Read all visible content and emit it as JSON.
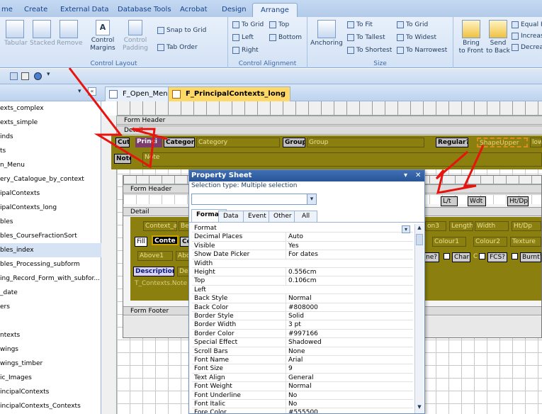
{
  "ribbon_tabs": [
    "me",
    "Create",
    "External Data",
    "Database Tools",
    "Acrobat",
    "Design",
    "Arrange"
  ],
  "active_ribbon_tab": "Arrange",
  "control_layout": {
    "label": "Control Layout",
    "tabular": "Tabular",
    "stacked": "Stacked",
    "remove": "Remove",
    "margins_1": "Control",
    "margins_2": "Margins",
    "padding_1": "Control",
    "padding_2": "Padding",
    "snap_to_grid": "Snap to Grid",
    "tab_order": "Tab Order"
  },
  "control_alignment": {
    "label": "Control Alignment",
    "to_grid": "To Grid",
    "left": "Left",
    "right": "Right",
    "top": "Top",
    "bottom": "Bottom"
  },
  "size": {
    "label": "Size",
    "to_fit": "To Fit",
    "to_tallest": "To Tallest",
    "to_shortest": "To Shortest",
    "to_grid": "To Grid",
    "to_widest": "To Widest",
    "to_narrowest": "To Narrowest"
  },
  "position": {
    "anchoring": "Anchoring",
    "bring_1": "Bring",
    "bring_2": "to Front",
    "send_1": "Send",
    "send_2": "to Back",
    "equal": "Equal H",
    "increase": "Increas",
    "decrease": "Decrea"
  },
  "nav_items": [
    "exts_complex",
    "exts_simple",
    "inds",
    "ts",
    "n_Menu",
    "ery_Catalogue_by_context",
    "ipalContexts",
    "ipalContexts_long",
    "bles",
    "bles_CourseFractionSort",
    "bles_index",
    "bles_Processing_subform",
    "ing_Record_Form_with_subfor...",
    "_date",
    "ers",
    "",
    "ntexts",
    "wings",
    "wings_timber",
    "ic_Images",
    "incipalContexts",
    "incipalContexts_Contexts"
  ],
  "selected_nav_index": 10,
  "doc_tabs": [
    "F_Open_Menu",
    "F_PrincipalContexts_long"
  ],
  "active_doc_tab": 1,
  "outer_form": {
    "form_header": "Form Header",
    "detail": "Detail",
    "cut": "Cut",
    "princ": "Princi",
    "category_lbl": "Category",
    "category_txt": "Category",
    "group_lbl": "Group",
    "group_txt": "Group",
    "regular": "Regular?",
    "shapeupper": "ShapeUpper",
    "low": "low",
    "note_lbl": "Note",
    "note_txt": "Note"
  },
  "inner_form": {
    "form_header": "Form Header",
    "detail": "Detail",
    "form_footer": "Form Footer",
    "lt": "L/t",
    "wdt": "Wdt",
    "htdp": "Ht/Dp",
    "context_a": "Context_a",
    "be": "Be",
    "fill": "Fill",
    "conte": "Conte",
    "co": "Co",
    "above1": "Above1",
    "abo": "Abo",
    "description": "Description",
    "de": "De",
    "t_contexts_note": "T_Contexts.Note",
    "on3": "on3",
    "length": "Length",
    "width": "Width",
    "htdp2": "Ht/Dp",
    "colour1": "Colour1",
    "colour2": "Colour2",
    "texture": "Texture",
    "ne": "ne?",
    "char": "Char",
    "c": "C",
    "fcs": "FCS?",
    "burnt": "Burnt?"
  },
  "property_sheet": {
    "title": "Property Sheet",
    "selection_label": "Selection type:",
    "selection_value": "Multiple selection",
    "tabs": [
      "Format",
      "Data",
      "Event",
      "Other",
      "All"
    ],
    "active_tab": "Format",
    "rows": [
      [
        "Format",
        ""
      ],
      [
        "Decimal Places",
        "Auto"
      ],
      [
        "Visible",
        "Yes"
      ],
      [
        "Show Date Picker",
        "For dates"
      ],
      [
        "Width",
        ""
      ],
      [
        "Height",
        "0.556cm"
      ],
      [
        "Top",
        "0.106cm"
      ],
      [
        "Left",
        ""
      ],
      [
        "Back Style",
        "Normal"
      ],
      [
        "Back Color",
        "#808000"
      ],
      [
        "Border Style",
        "Solid"
      ],
      [
        "Border Width",
        "3 pt"
      ],
      [
        "Border Color",
        "#997166"
      ],
      [
        "Special Effect",
        "Shadowed"
      ],
      [
        "Scroll Bars",
        "None"
      ],
      [
        "Font Name",
        "Arial"
      ],
      [
        "Font Size",
        "9"
      ],
      [
        "Text Align",
        "General"
      ],
      [
        "Font Weight",
        "Normal"
      ],
      [
        "Font Underline",
        "No"
      ],
      [
        "Font Italic",
        "No"
      ],
      [
        "Fore Color",
        "#555500"
      ]
    ]
  },
  "arrow_color": "#e8130f"
}
